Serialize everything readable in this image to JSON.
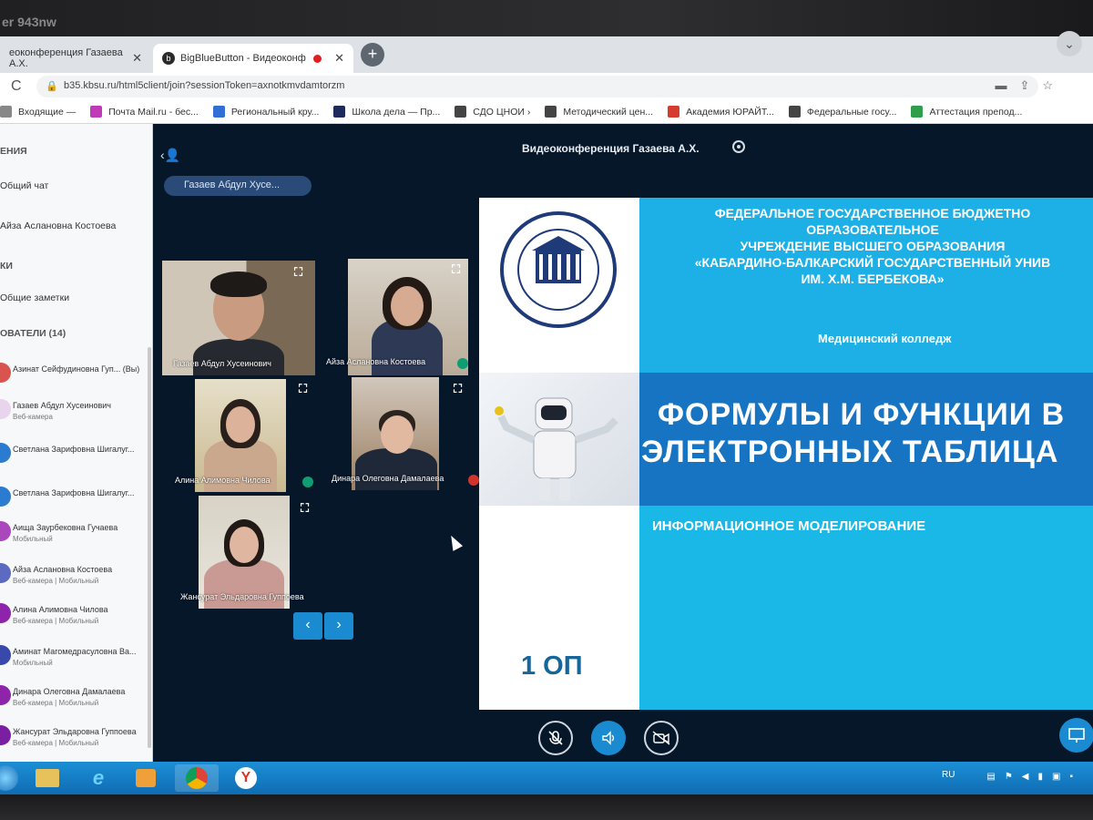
{
  "monitor": {
    "brand_text": "er 943nw"
  },
  "tabs": [
    {
      "label": "еоконференция Газаева А.Х.",
      "close": "✕",
      "active": false
    },
    {
      "label": "BigBlueButton - Видеоконф",
      "close": "✕",
      "active": true,
      "recording": true
    }
  ],
  "new_tab": "+",
  "address": {
    "url": "b35.kbsu.ru/html5client/join?sessionToken=axnotkmvdamtorzm",
    "reload": "C"
  },
  "bookmarks": [
    {
      "label": "Входящие —",
      "icon": "mail-icon",
      "color": "#888888"
    },
    {
      "label": "Почта Mail.ru - бес...",
      "icon": "mailru-icon",
      "color": "#c03ab8"
    },
    {
      "label": "Региональный кру...",
      "icon": "globe-icon",
      "color": "#2f6fd6"
    },
    {
      "label": "Школа дела — Пр...",
      "icon": "book-icon",
      "color": "#1e2a5a"
    },
    {
      "label": "СДО ЦНОИ ›",
      "icon": "globe-icon",
      "color": "#444444"
    },
    {
      "label": "Методический цен...",
      "icon": "globe-icon",
      "color": "#444444"
    },
    {
      "label": "Академия ЮРАЙТ...",
      "icon": "urait-icon",
      "color": "#d63b2f"
    },
    {
      "label": "Федеральные госу...",
      "icon": "globe-icon",
      "color": "#444444"
    },
    {
      "label": "Аттестация препод...",
      "icon": "sheet-icon",
      "color": "#2e9e4a"
    }
  ],
  "left_panel": {
    "messages_heading": "ЕНИЯ",
    "public_chat": "Общий чат",
    "private_chat": "Айза Аслановна Костоева",
    "notes_heading": "КИ",
    "shared_notes": "Общие заметки",
    "users_heading": "ОВАТЕЛИ (14)",
    "users": [
      {
        "name": "Азинат Сейфудиновна Гуп... (Вы)",
        "status": "",
        "color": "#d9534f"
      },
      {
        "name": "Газаев Абдул Хусеинович",
        "status": "Веб-камера",
        "color": "#e8d4ec"
      },
      {
        "name": "Светлана Зарифовна Шигалуг...",
        "status": "",
        "color": "#2b7bd0"
      },
      {
        "name": "Светлана Зарифовна Шигалуг...",
        "status": "",
        "color": "#2b7bd0"
      },
      {
        "name": "Аища Заурбековна Гучаева",
        "status": "Мобильный",
        "color": "#ab47bc"
      },
      {
        "name": "Айза Аслановна Костоева",
        "status": "Веб-камера | Мобильный",
        "color": "#5c6bc0"
      },
      {
        "name": "Алина Алимовна Чилова",
        "status": "Веб-камера | Мобильный",
        "color": "#8e24aa"
      },
      {
        "name": "Аминат Магомедрасуловна Ва...",
        "status": "Мобильный",
        "color": "#3949ab"
      },
      {
        "name": "Динара Олеговна Дамалаева",
        "status": "Веб-камера | Мобильный",
        "color": "#8e24aa"
      },
      {
        "name": "Жансурат Эльдаровна Гуппоева",
        "status": "Веб-камера | Мобильный",
        "color": "#7b1fa2"
      }
    ]
  },
  "conference": {
    "title": "Видеоконференция Газаева А.Х.",
    "presenter_pill": "Газаев Абдул Хусе...",
    "videos": [
      {
        "name": "Газаев Абдул Хусеинович"
      },
      {
        "name": "Айза Аслановна Костоева"
      },
      {
        "name": "Алина Алимовна Чилова"
      },
      {
        "name": "Динара Олеговна Дамалаева"
      },
      {
        "name": "Жансурат Эльдаровна Гуппоева"
      }
    ],
    "prev": "‹",
    "next": "›"
  },
  "slide": {
    "org_lines": [
      "ФЕДЕРАЛЬНОЕ ГОСУДАРСТВЕННОЕ БЮДЖЕТНО",
      "ОБРАЗОВАТЕЛЬНОЕ",
      "УЧРЕЖДЕНИЕ ВЫСШЕГО ОБРАЗОВАНИЯ",
      "«КАБАРДИНО-БАЛКАРСКИЙ ГОСУДАРСТВЕННЫЙ УНИВ",
      "ИМ. Х.М. БЕРБЕКОВА»"
    ],
    "college": "Медицинский колледж",
    "title_line1": "ФОРМУЛЫ И ФУНКЦИИ В",
    "title_line2": "ЭЛЕКТРОННЫХ ТАБЛИЦА",
    "subtitle": "ИНФОРМАЦИОННОЕ МОДЕЛИРОВАНИЕ",
    "group": "1 ОП",
    "logo_text": "МЕДИЦИНСКИЙ КОЛЛЕДЖ",
    "logo_year": "1932"
  },
  "taskbar": {
    "lang": "RU"
  },
  "colors": {
    "accent": "#1a8bd1",
    "bg_dark": "#06172a",
    "slide_light": "#1db0e6",
    "slide_dark": "#1774c2"
  }
}
